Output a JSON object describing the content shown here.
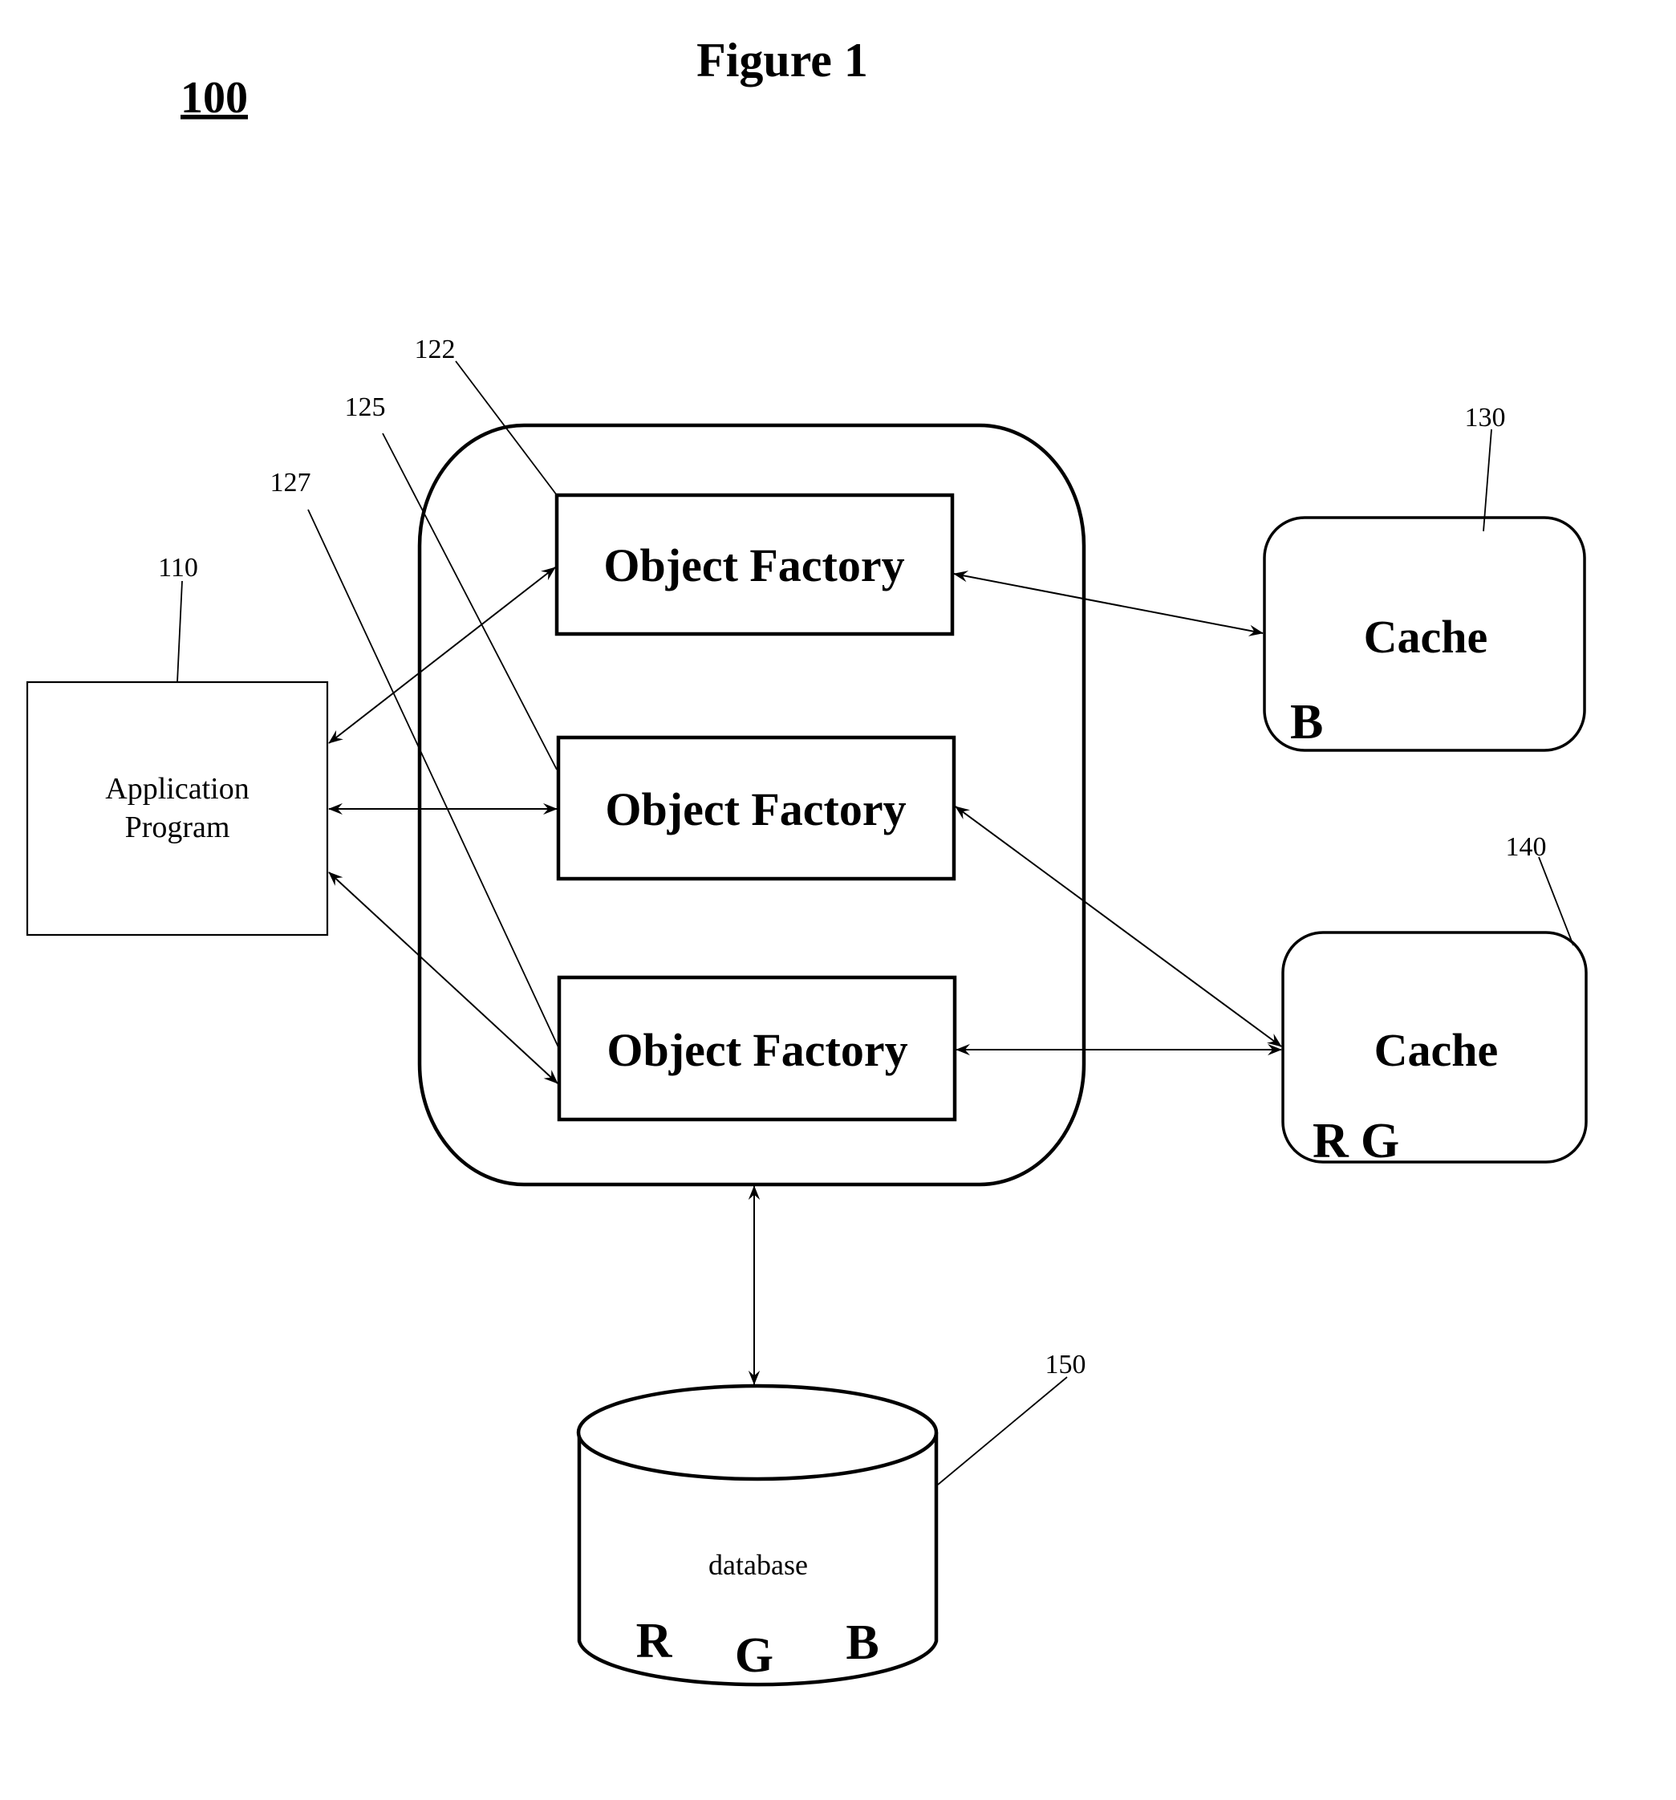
{
  "figure": {
    "title": "Figure 1",
    "number": "100"
  },
  "nodes": {
    "application": {
      "ref": "110",
      "lines": [
        "Application",
        "Program"
      ]
    },
    "object_factories": [
      {
        "ref": "122",
        "label": "Object Factory"
      },
      {
        "ref": "125",
        "label": "Object Factory"
      },
      {
        "ref": "127",
        "label": "Object Factory"
      }
    ],
    "cache_1": {
      "ref": "130",
      "label": "Cache",
      "contents": [
        "B"
      ]
    },
    "cache_2": {
      "ref": "140",
      "label": "Cache",
      "contents": [
        "R",
        "G"
      ]
    },
    "database": {
      "ref": "150",
      "label": "database",
      "contents": [
        "R",
        "G",
        "B"
      ]
    }
  },
  "connections": [
    {
      "from": "Application Program",
      "to": "Object Factory 122",
      "type": "bidirectional"
    },
    {
      "from": "Application Program",
      "to": "Object Factory 125",
      "type": "bidirectional"
    },
    {
      "from": "Application Program",
      "to": "Object Factory 127",
      "type": "bidirectional"
    },
    {
      "from": "Object Factory 122",
      "to": "Cache 130",
      "type": "bidirectional"
    },
    {
      "from": "Object Factory 125",
      "to": "Cache 140",
      "type": "bidirectional"
    },
    {
      "from": "Object Factory 127",
      "to": "Cache 140",
      "type": "bidirectional"
    },
    {
      "from": "Object Factory group",
      "to": "database 150",
      "type": "bidirectional"
    }
  ],
  "colors": {
    "ink": "#000000",
    "background": "#ffffff"
  }
}
